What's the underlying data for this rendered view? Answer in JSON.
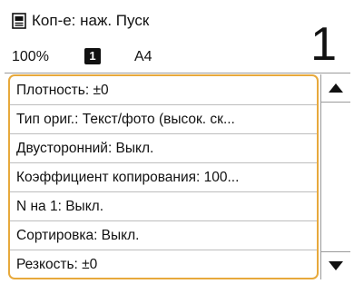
{
  "header": {
    "title": "Коп-е: наж. Пуск",
    "zoom": "100%",
    "paper_source": "1",
    "paper_size": "A4",
    "copies": "1"
  },
  "menu": {
    "items": [
      "Плотность: ±0",
      "Тип ориг.: Текст/фото (высок. ск...",
      "Двусторонний: Выкл.",
      "Коэффициент копирования: 100...",
      "N на 1: Выкл.",
      "Сортировка: Выкл.",
      "Резкость: ±0"
    ]
  },
  "icons": {
    "document": "document-icon",
    "scroll_up": "triangle-up-icon",
    "scroll_down": "triangle-down-icon"
  },
  "colors": {
    "highlight_border": "#e7a93c",
    "separator": "#bdbdbd",
    "text": "#111111"
  }
}
